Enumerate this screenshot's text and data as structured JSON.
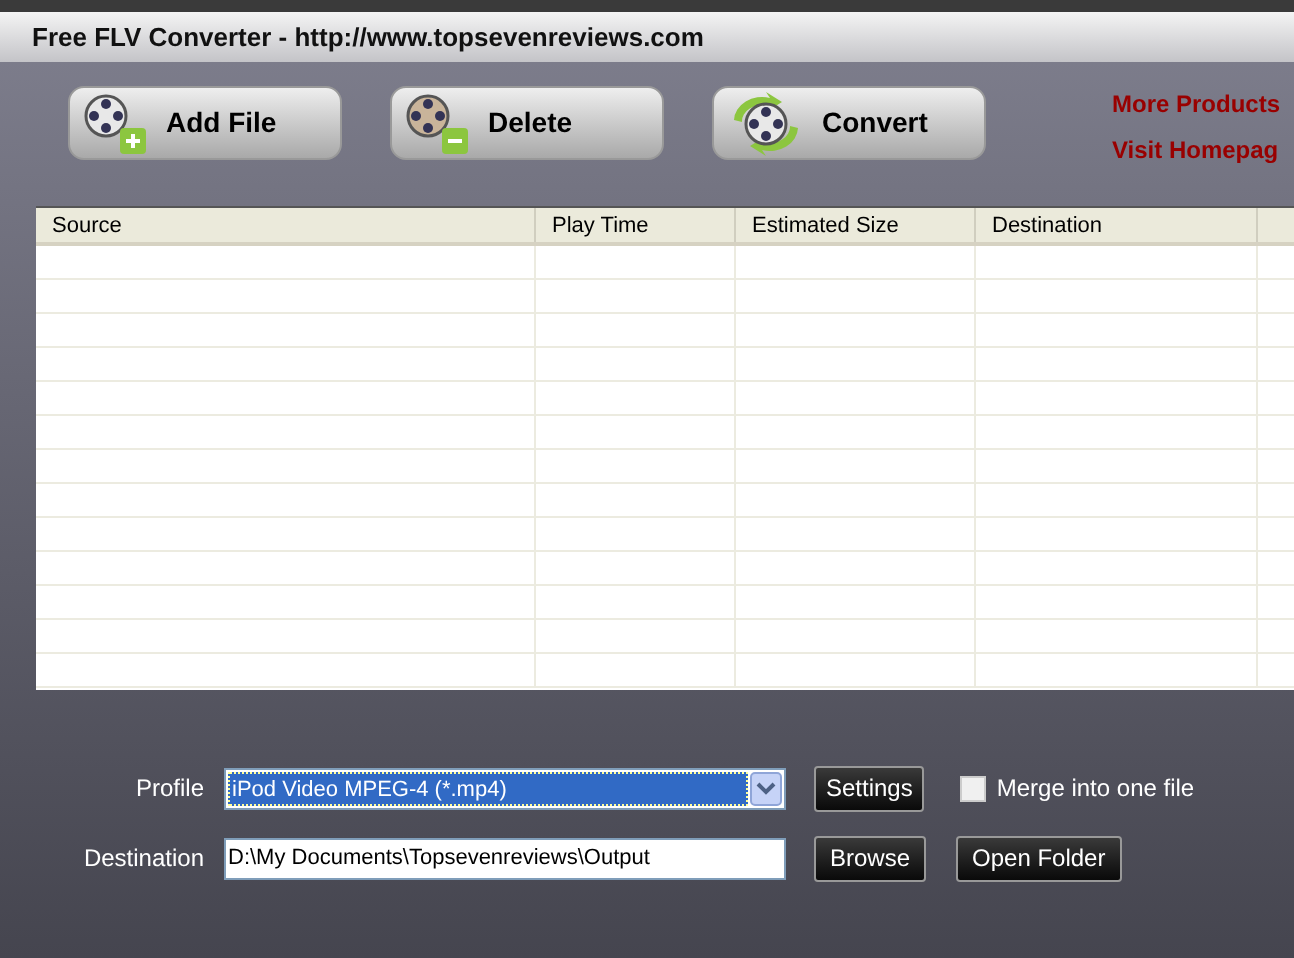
{
  "window": {
    "title": "Free FLV Converter - http://www.topsevenreviews.com"
  },
  "toolbar": [
    {
      "kind": "add",
      "label": "Add File"
    },
    {
      "kind": "delete",
      "label": "Delete"
    },
    {
      "kind": "convert",
      "label": "Convert"
    }
  ],
  "links": [
    "More Products",
    "Visit Homepag"
  ],
  "table": {
    "columns": [
      "Source",
      "Play Time",
      "Estimated Size",
      "Destination"
    ]
  },
  "profile": {
    "label": "Profile",
    "value": "iPod Video MPEG-4 (*.mp4)",
    "button": "Settings"
  },
  "merge": {
    "label": "Merge into one file",
    "checked": false
  },
  "destination": {
    "label": "Destination",
    "value": "D:\\My Documents\\Topsevenreviews\\Output",
    "buttons": [
      "Browse",
      "Open Folder"
    ]
  }
}
